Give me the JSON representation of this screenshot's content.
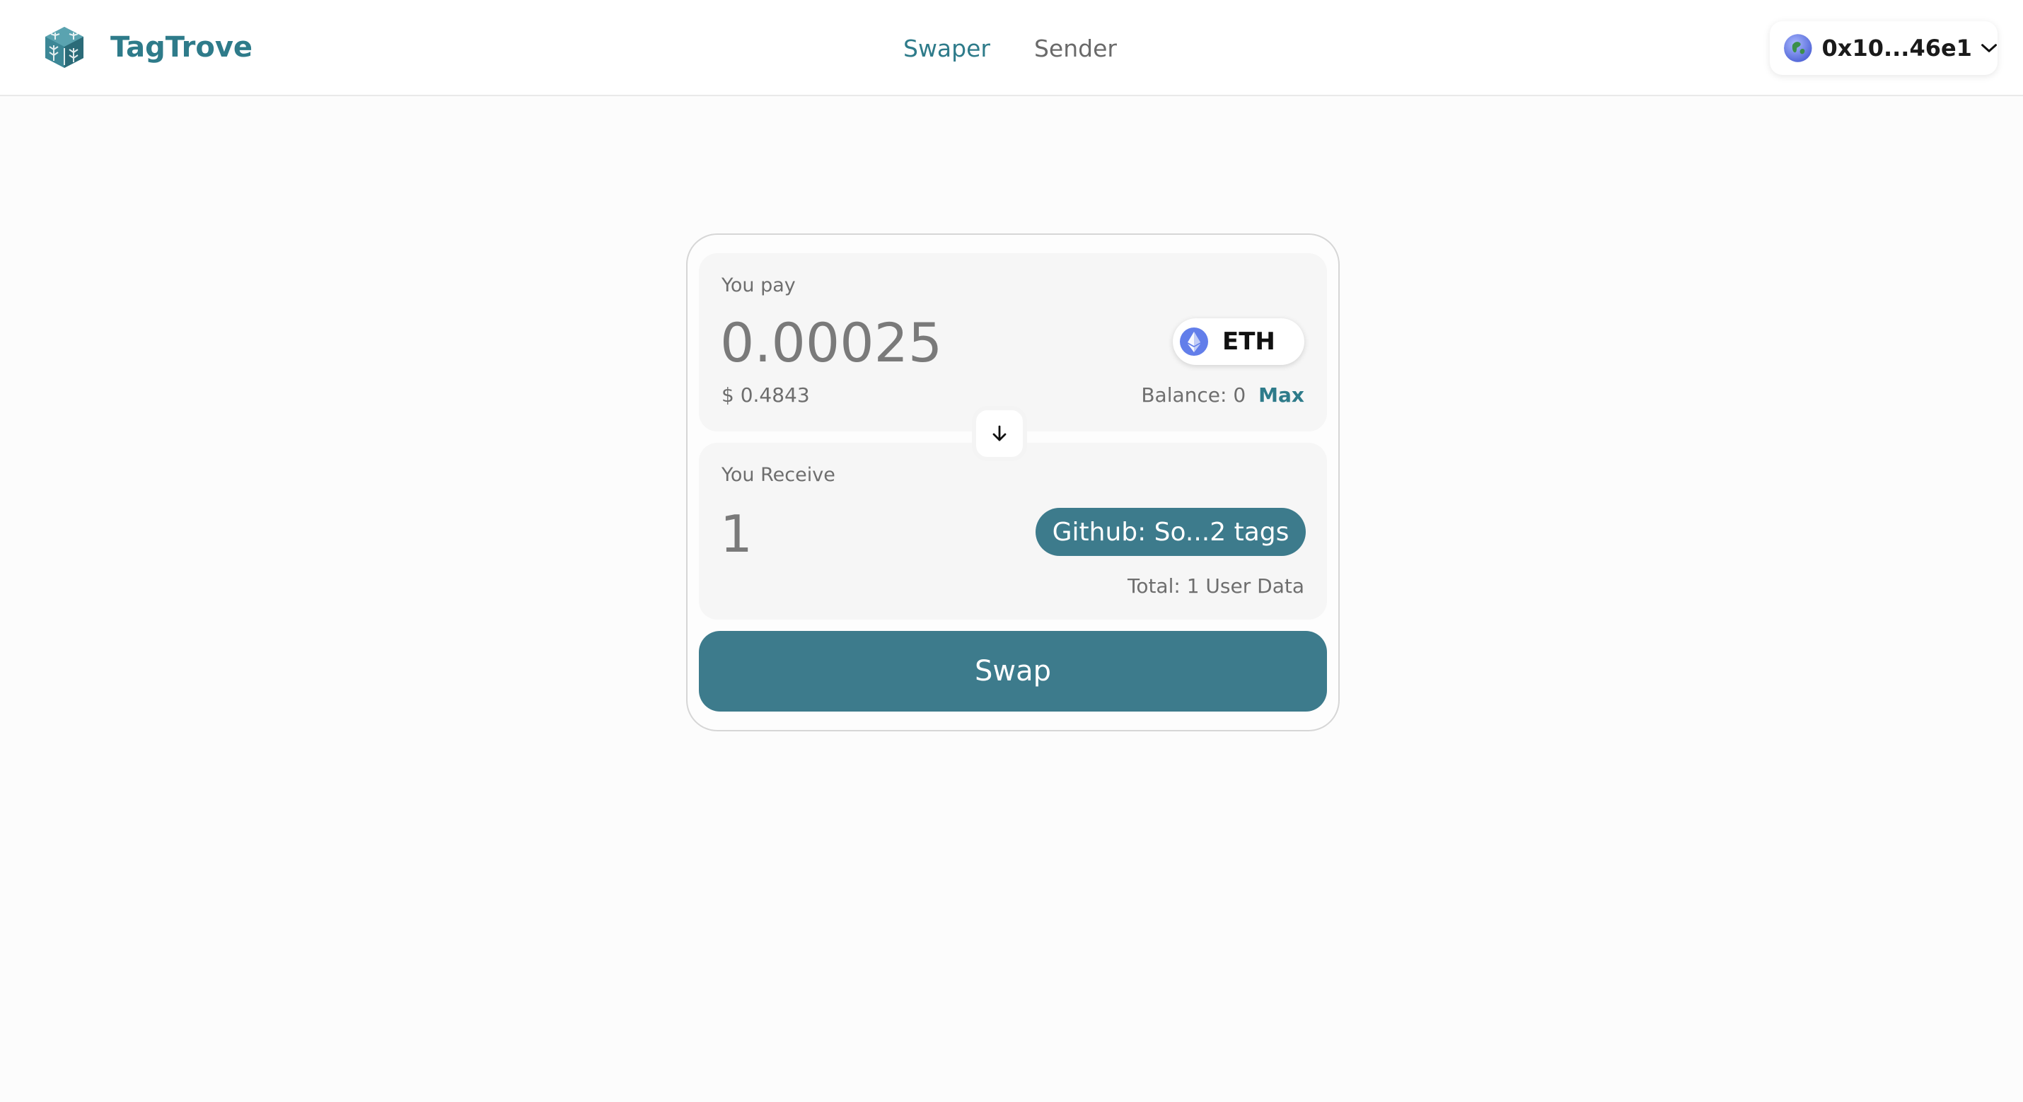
{
  "header": {
    "brand_name": "TagTrove",
    "logo_icon": "cube-tree-logo",
    "nav": [
      {
        "label": "Swaper",
        "active": true
      },
      {
        "label": "Sender",
        "active": false
      }
    ],
    "wallet": {
      "avatar_icon": "globe-avatar-icon",
      "address": "0x10...46e1",
      "chevron_icon": "chevron-down-icon"
    }
  },
  "swap": {
    "pay": {
      "label": "You pay",
      "amount": "0.00025",
      "usd_value": "$ 0.4843",
      "token": {
        "icon": "ethereum-icon",
        "symbol": "ETH"
      },
      "balance_label": "Balance: 0",
      "max_label": "Max"
    },
    "toggle_icon": "arrow-down-icon",
    "receive": {
      "label": "You Receive",
      "amount": "1",
      "tag_label": "Github: So...2 tags",
      "total": "Total: 1 User Data"
    },
    "swap_label": "Swap"
  },
  "colors": {
    "brand": "#2e7b8a",
    "button": "#3d7b8c",
    "eth_icon": "#627eea",
    "background": "#fcfcfc"
  }
}
